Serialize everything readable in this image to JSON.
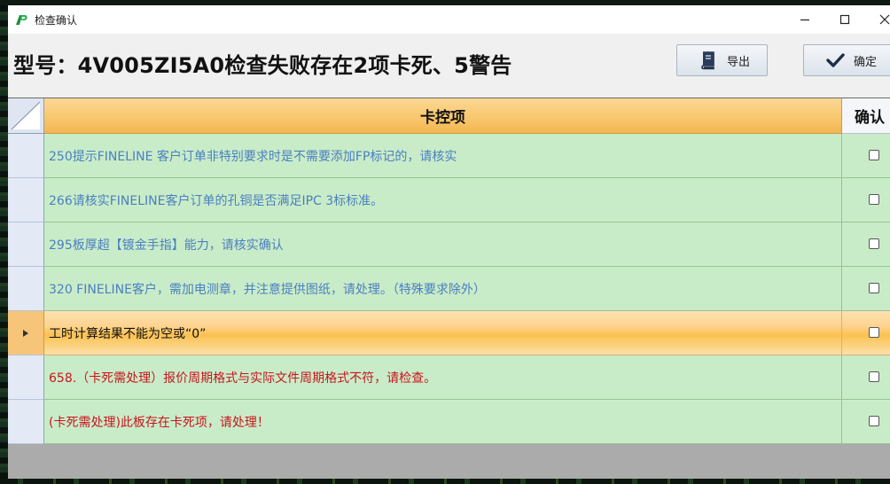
{
  "window": {
    "title": "检查确认"
  },
  "header": {
    "heading": "型号：4V005ZI5A0检查失败存在2项卡死、5警告",
    "export_label": "导出",
    "confirm_label": "确定"
  },
  "grid": {
    "columns": {
      "item": "卡控项",
      "confirm": "确认"
    },
    "rows": [
      {
        "text": "250提示FINELINE 客户订单非特别要求时是不需要添加FP标记的，请核实",
        "color": "blue",
        "checked": false
      },
      {
        "text": "266请核实FINELINE客户订单的孔铜是否满足IPC 3标标准。",
        "color": "blue",
        "checked": false
      },
      {
        "text": "295板厚超【镀金手指】能力，请核实确认",
        "color": "blue",
        "checked": false
      },
      {
        "text": "320 FINELINE客户，需加电测章，并注意提供图纸，请处理。（特殊要求除外）",
        "color": "blue",
        "checked": false
      },
      {
        "text": "工时计算结果不能为空或“0”",
        "color": "dark",
        "checked": false,
        "selected": true
      },
      {
        "text": "658.（卡死需处理）报价周期格式与实际文件周期格式不符，请检查。",
        "color": "red",
        "checked": false
      },
      {
        "text": "(卡死需处理)此板存在卡死项，请处理！",
        "color": "red",
        "checked": false
      }
    ]
  },
  "colors": {
    "warning": "#4a7fc1",
    "blocking": "#c8141e",
    "row_bg": "#c9ecc8",
    "header_bg": "#f8c76e"
  },
  "icons": {
    "export": "book-icon",
    "confirm": "checkmark-icon"
  }
}
